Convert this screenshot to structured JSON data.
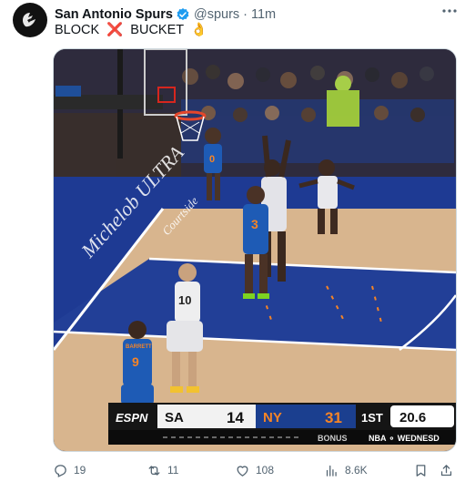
{
  "account": {
    "display_name": "San Antonio Spurs",
    "handle": "@spurs",
    "separator": "·",
    "time_ago": "11m"
  },
  "tweet": {
    "text_before": "BLOCK",
    "text_after": "BUCKET",
    "cross_glyph": "❌",
    "ok_glyph": "👌"
  },
  "video": {
    "scorebug": {
      "broadcaster": "ESPN",
      "away_team": "SA",
      "away_score": "14",
      "home_team": "NY",
      "home_score": "31",
      "quarter": "1ST",
      "clock": "20.6",
      "bonus": "BONUS",
      "ticker": "NBA ⚬ WEDNESD"
    },
    "court_ad_text": "Michelob ULTRA",
    "court_ad_sub": "Courtside",
    "jerseys": {
      "knicks_left": "9",
      "spurs_left": "10",
      "knicks_center": "3",
      "knicks_back": "0"
    },
    "jersey_names": {
      "knicks_left": "BARRETT"
    }
  },
  "actions": {
    "replies": "19",
    "reposts": "11",
    "likes": "108",
    "views": "8.6K"
  },
  "colors": {
    "brand_blue": "#1d9bf0",
    "knicks_blue": "#1e5bb5",
    "knicks_orange": "#f58426",
    "court_wood": "#d6b28a",
    "paint_blue": "#1f3a8f"
  }
}
